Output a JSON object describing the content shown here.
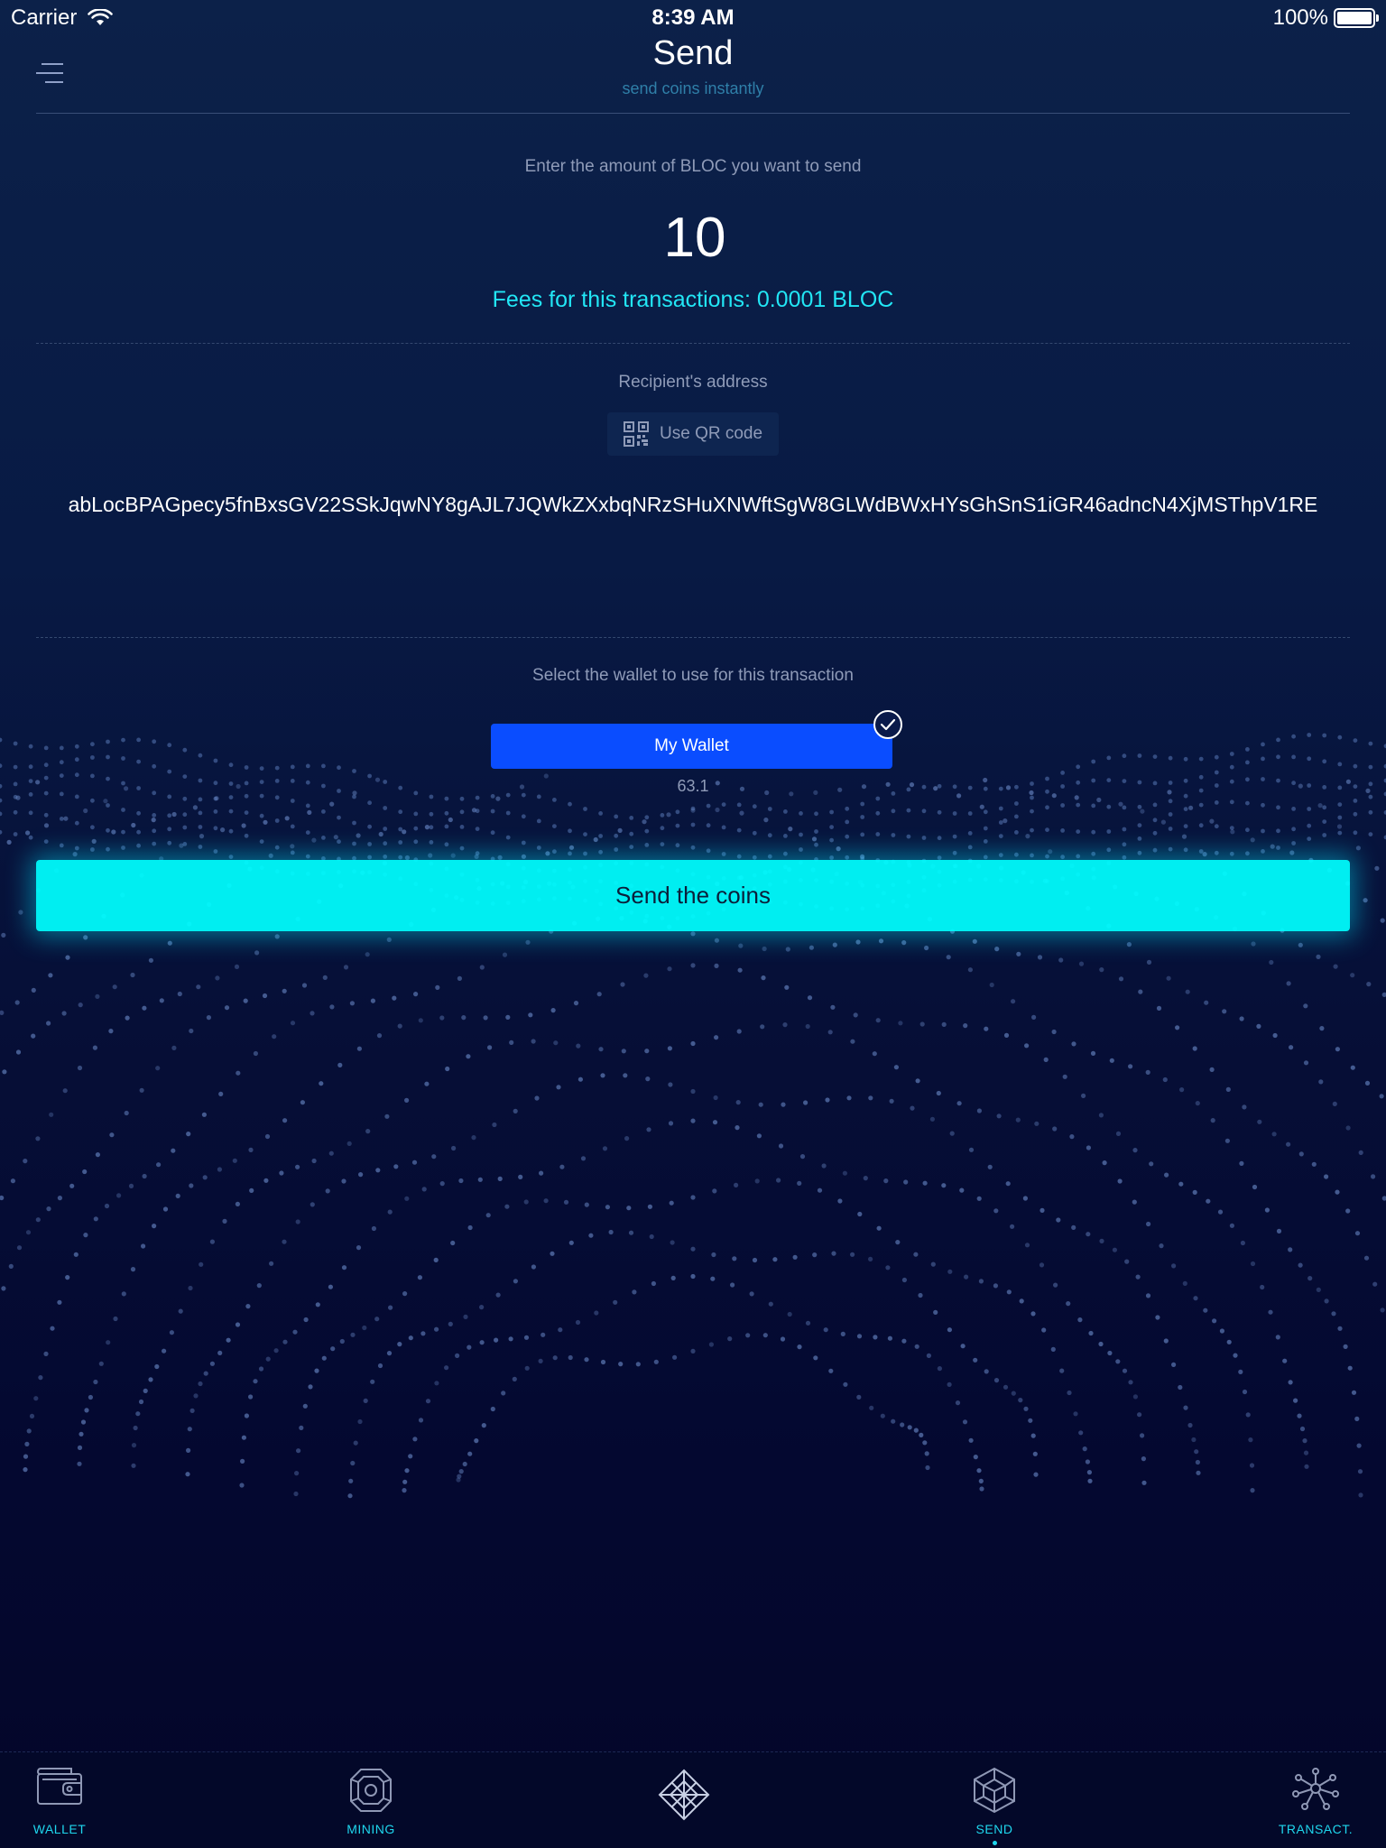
{
  "status_bar": {
    "carrier": "Carrier",
    "time": "8:39 AM",
    "battery": "100%"
  },
  "header": {
    "title": "Send",
    "subtitle": "send coins instantly"
  },
  "amount": {
    "prompt": "Enter the amount of BLOC you want to send",
    "value": "10",
    "fees": "Fees for this transactions: 0.0001 BLOC"
  },
  "recipient": {
    "label": "Recipient's address",
    "qr_button_label": "Use QR code",
    "address": "abLocBPAGpecy5fnBxsGV22SSkJqwNY8gAJL7JQWkZXxbqNRzSHuXNWftSgW8GLWdBWxHYsGhSnS1iGR46adncN4XjMSThpV1RE"
  },
  "wallet": {
    "prompt": "Select the wallet to use for this transaction",
    "name": "My Wallet",
    "balance": "63.1",
    "selected": true
  },
  "send_button_label": "Send the coins",
  "tabs": [
    {
      "label": "WALLET",
      "icon": "wallet-icon"
    },
    {
      "label": "MINING",
      "icon": "mining-chip-icon"
    },
    {
      "label": "",
      "icon": "diamond-logo-icon"
    },
    {
      "label": "SEND",
      "icon": "send-cube-icon",
      "active": true
    },
    {
      "label": "TRANSACT.",
      "icon": "network-icon"
    }
  ],
  "colors": {
    "accent_cyan": "#00ffff",
    "wallet_blue": "#0a4dff",
    "fees_cyan": "#22e6f5",
    "background": "#081a44"
  }
}
